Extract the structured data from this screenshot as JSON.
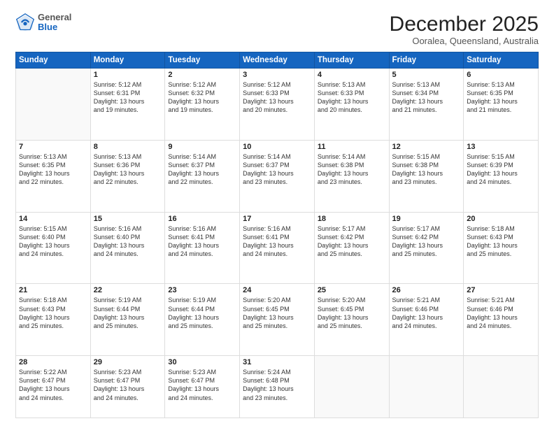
{
  "logo": {
    "general": "General",
    "blue": "Blue"
  },
  "header": {
    "month": "December 2025",
    "location": "Ooralea, Queensland, Australia"
  },
  "days_of_week": [
    "Sunday",
    "Monday",
    "Tuesday",
    "Wednesday",
    "Thursday",
    "Friday",
    "Saturday"
  ],
  "weeks": [
    [
      {
        "day": "",
        "info": ""
      },
      {
        "day": "1",
        "info": "Sunrise: 5:12 AM\nSunset: 6:31 PM\nDaylight: 13 hours\nand 19 minutes."
      },
      {
        "day": "2",
        "info": "Sunrise: 5:12 AM\nSunset: 6:32 PM\nDaylight: 13 hours\nand 19 minutes."
      },
      {
        "day": "3",
        "info": "Sunrise: 5:12 AM\nSunset: 6:33 PM\nDaylight: 13 hours\nand 20 minutes."
      },
      {
        "day": "4",
        "info": "Sunrise: 5:13 AM\nSunset: 6:33 PM\nDaylight: 13 hours\nand 20 minutes."
      },
      {
        "day": "5",
        "info": "Sunrise: 5:13 AM\nSunset: 6:34 PM\nDaylight: 13 hours\nand 21 minutes."
      },
      {
        "day": "6",
        "info": "Sunrise: 5:13 AM\nSunset: 6:35 PM\nDaylight: 13 hours\nand 21 minutes."
      }
    ],
    [
      {
        "day": "7",
        "info": "Sunrise: 5:13 AM\nSunset: 6:35 PM\nDaylight: 13 hours\nand 22 minutes."
      },
      {
        "day": "8",
        "info": "Sunrise: 5:13 AM\nSunset: 6:36 PM\nDaylight: 13 hours\nand 22 minutes."
      },
      {
        "day": "9",
        "info": "Sunrise: 5:14 AM\nSunset: 6:37 PM\nDaylight: 13 hours\nand 22 minutes."
      },
      {
        "day": "10",
        "info": "Sunrise: 5:14 AM\nSunset: 6:37 PM\nDaylight: 13 hours\nand 23 minutes."
      },
      {
        "day": "11",
        "info": "Sunrise: 5:14 AM\nSunset: 6:38 PM\nDaylight: 13 hours\nand 23 minutes."
      },
      {
        "day": "12",
        "info": "Sunrise: 5:15 AM\nSunset: 6:38 PM\nDaylight: 13 hours\nand 23 minutes."
      },
      {
        "day": "13",
        "info": "Sunrise: 5:15 AM\nSunset: 6:39 PM\nDaylight: 13 hours\nand 24 minutes."
      }
    ],
    [
      {
        "day": "14",
        "info": "Sunrise: 5:15 AM\nSunset: 6:40 PM\nDaylight: 13 hours\nand 24 minutes."
      },
      {
        "day": "15",
        "info": "Sunrise: 5:16 AM\nSunset: 6:40 PM\nDaylight: 13 hours\nand 24 minutes."
      },
      {
        "day": "16",
        "info": "Sunrise: 5:16 AM\nSunset: 6:41 PM\nDaylight: 13 hours\nand 24 minutes."
      },
      {
        "day": "17",
        "info": "Sunrise: 5:16 AM\nSunset: 6:41 PM\nDaylight: 13 hours\nand 24 minutes."
      },
      {
        "day": "18",
        "info": "Sunrise: 5:17 AM\nSunset: 6:42 PM\nDaylight: 13 hours\nand 25 minutes."
      },
      {
        "day": "19",
        "info": "Sunrise: 5:17 AM\nSunset: 6:42 PM\nDaylight: 13 hours\nand 25 minutes."
      },
      {
        "day": "20",
        "info": "Sunrise: 5:18 AM\nSunset: 6:43 PM\nDaylight: 13 hours\nand 25 minutes."
      }
    ],
    [
      {
        "day": "21",
        "info": "Sunrise: 5:18 AM\nSunset: 6:43 PM\nDaylight: 13 hours\nand 25 minutes."
      },
      {
        "day": "22",
        "info": "Sunrise: 5:19 AM\nSunset: 6:44 PM\nDaylight: 13 hours\nand 25 minutes."
      },
      {
        "day": "23",
        "info": "Sunrise: 5:19 AM\nSunset: 6:44 PM\nDaylight: 13 hours\nand 25 minutes."
      },
      {
        "day": "24",
        "info": "Sunrise: 5:20 AM\nSunset: 6:45 PM\nDaylight: 13 hours\nand 25 minutes."
      },
      {
        "day": "25",
        "info": "Sunrise: 5:20 AM\nSunset: 6:45 PM\nDaylight: 13 hours\nand 25 minutes."
      },
      {
        "day": "26",
        "info": "Sunrise: 5:21 AM\nSunset: 6:46 PM\nDaylight: 13 hours\nand 24 minutes."
      },
      {
        "day": "27",
        "info": "Sunrise: 5:21 AM\nSunset: 6:46 PM\nDaylight: 13 hours\nand 24 minutes."
      }
    ],
    [
      {
        "day": "28",
        "info": "Sunrise: 5:22 AM\nSunset: 6:47 PM\nDaylight: 13 hours\nand 24 minutes."
      },
      {
        "day": "29",
        "info": "Sunrise: 5:23 AM\nSunset: 6:47 PM\nDaylight: 13 hours\nand 24 minutes."
      },
      {
        "day": "30",
        "info": "Sunrise: 5:23 AM\nSunset: 6:47 PM\nDaylight: 13 hours\nand 24 minutes."
      },
      {
        "day": "31",
        "info": "Sunrise: 5:24 AM\nSunset: 6:48 PM\nDaylight: 13 hours\nand 23 minutes."
      },
      {
        "day": "",
        "info": ""
      },
      {
        "day": "",
        "info": ""
      },
      {
        "day": "",
        "info": ""
      }
    ]
  ]
}
